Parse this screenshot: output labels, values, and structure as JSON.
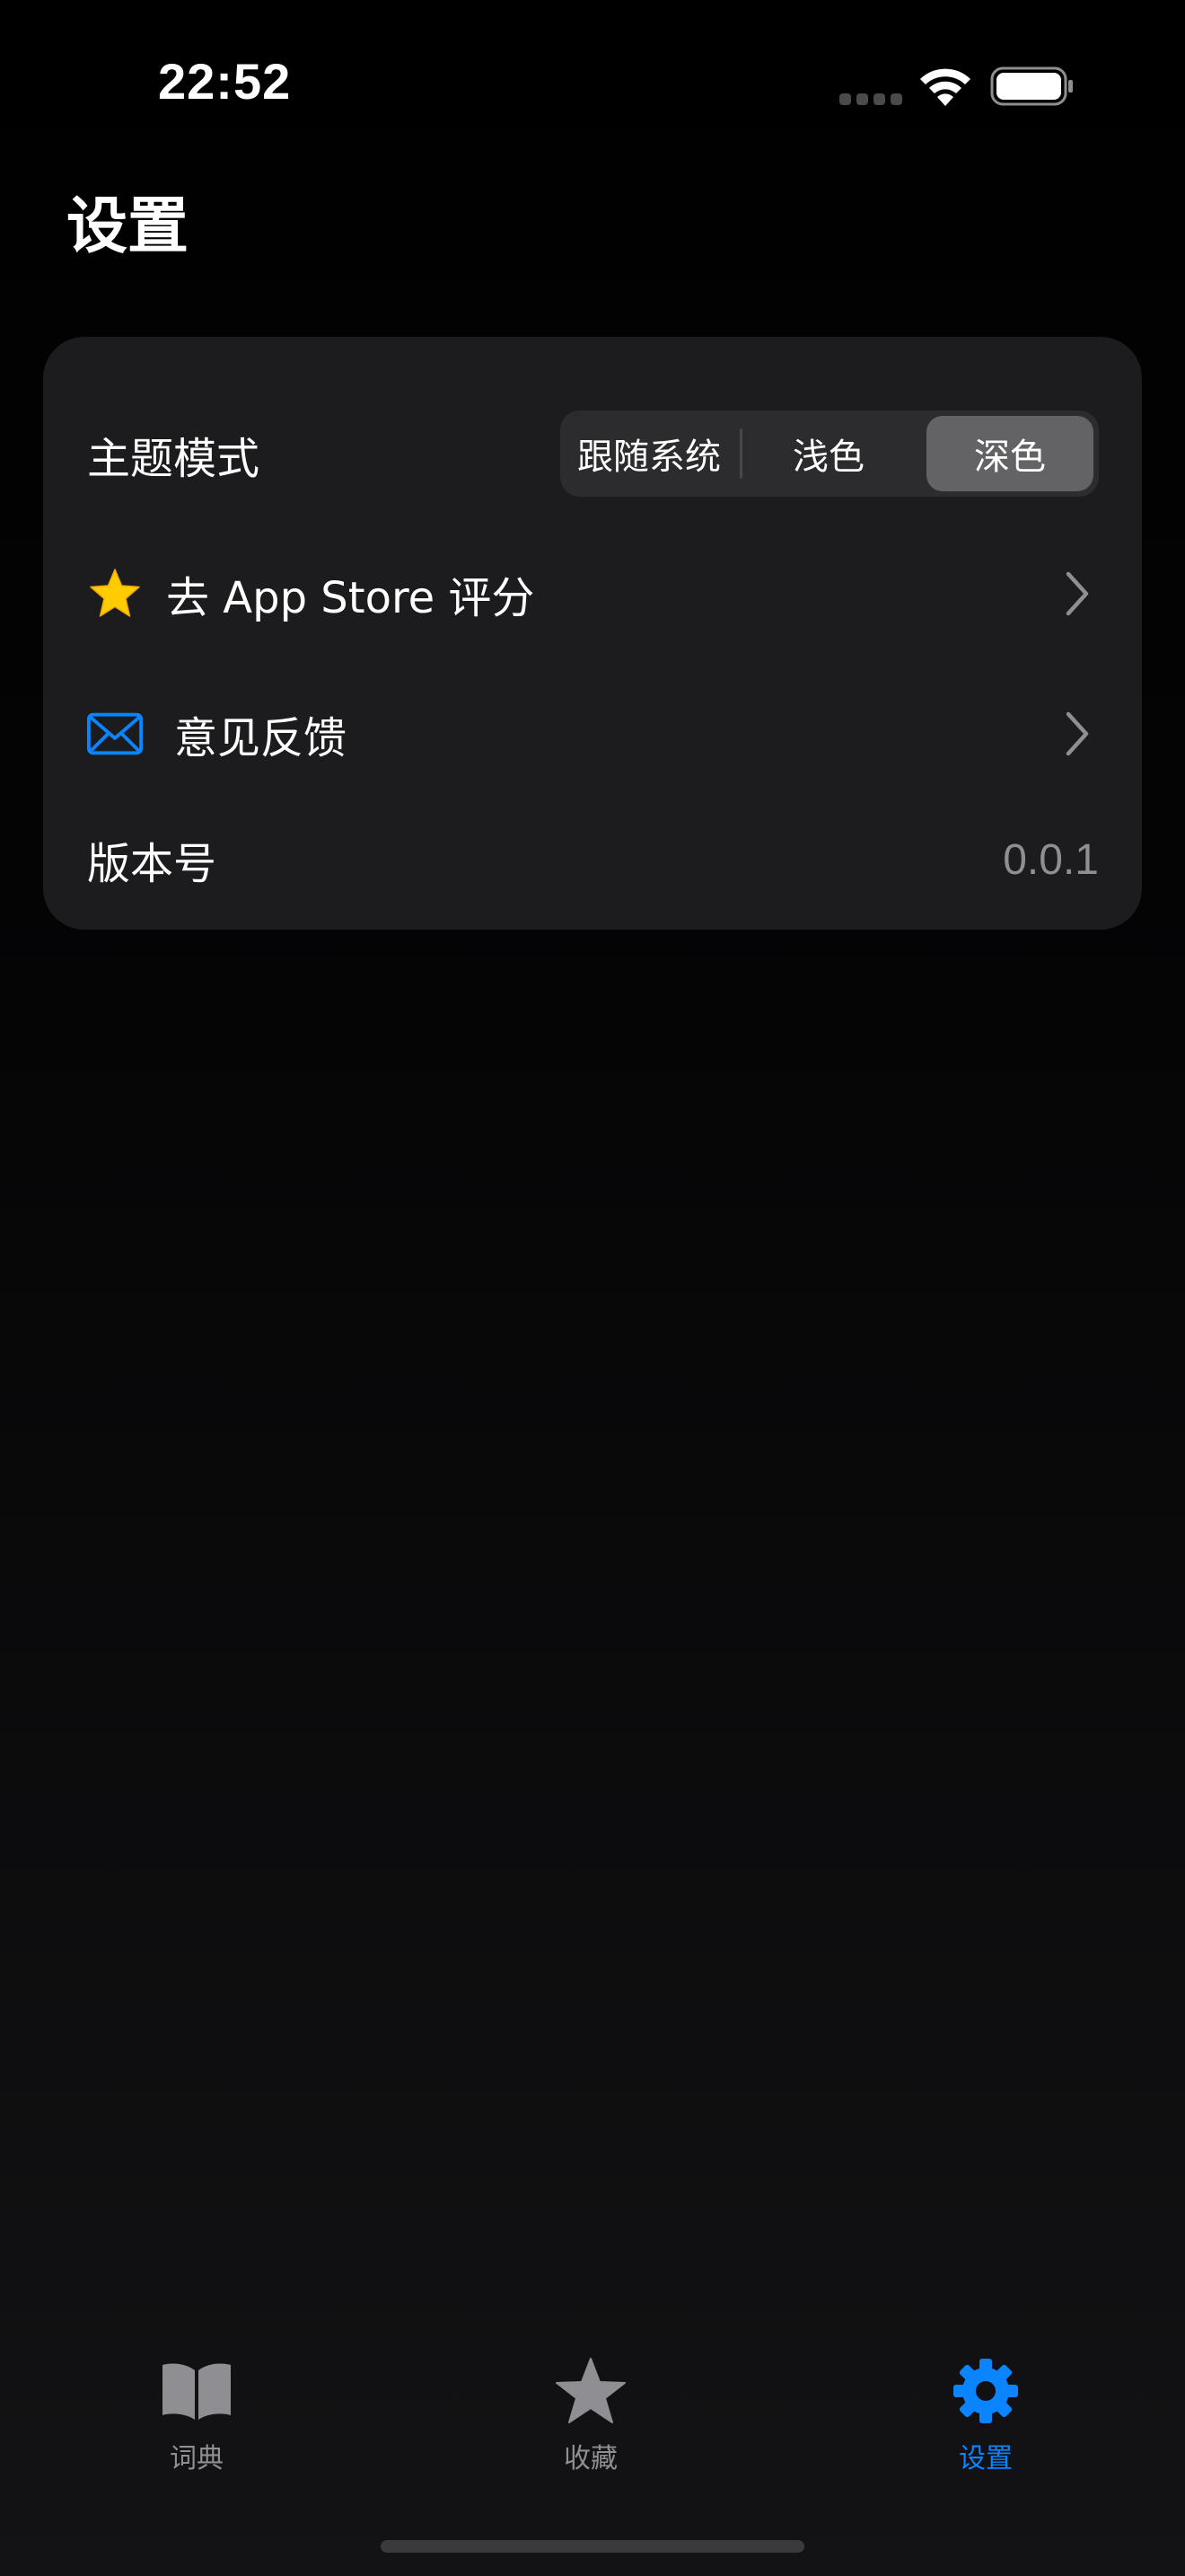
{
  "status_bar": {
    "time": "22:52"
  },
  "header": {
    "title": "设置"
  },
  "settings": {
    "theme": {
      "label": "主题模式",
      "options": [
        "跟随系统",
        "浅色",
        "深色"
      ],
      "selected": "深色"
    },
    "rate": {
      "label": "去 App Store 评分",
      "icon": "star-icon",
      "icon_color": "#FFCC00"
    },
    "feedback": {
      "label": "意见反馈",
      "icon": "envelope-icon",
      "icon_color": "#0A84FF"
    },
    "version": {
      "label": "版本号",
      "value": "0.0.1"
    }
  },
  "tab_bar": {
    "tabs": [
      {
        "label": "词典",
        "icon": "book-icon",
        "active": false
      },
      {
        "label": "收藏",
        "icon": "star-icon",
        "active": false
      },
      {
        "label": "设置",
        "icon": "gear-icon",
        "active": true
      }
    ],
    "active_color": "#0A84FF",
    "inactive_color": "#8E8E93"
  }
}
